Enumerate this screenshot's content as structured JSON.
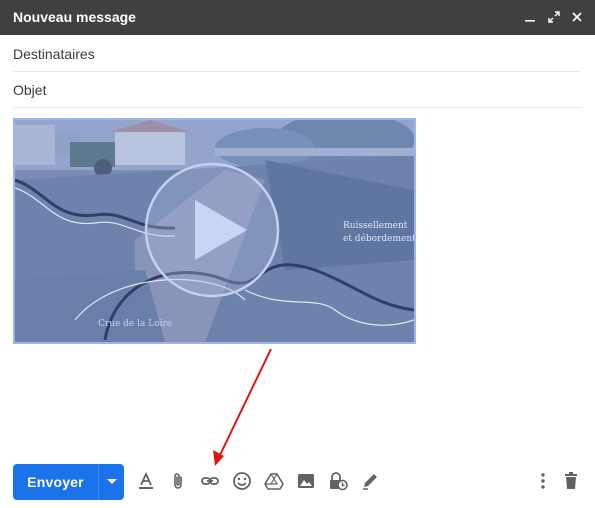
{
  "window": {
    "title": "Nouveau message",
    "controls": [
      "minimize-icon",
      "expand-icon",
      "close-icon"
    ]
  },
  "fields": {
    "recipients_placeholder": "Destinataires",
    "subject_placeholder": "Objet"
  },
  "video": {
    "caption_left": "Crue de la Loire",
    "caption_right_line1": "Ruissellement",
    "caption_right_line2": "et débordement"
  },
  "toolbar": {
    "send_label": "Envoyer",
    "send_options_icon": "caret-down-icon",
    "tools": [
      "format-text-icon",
      "attach-icon",
      "link-icon",
      "emoji-icon",
      "drive-icon",
      "photo-icon",
      "confidential-icon",
      "signature-icon"
    ],
    "more_icon": "more-vert-icon",
    "discard_icon": "trash-icon"
  },
  "colors": {
    "titlebar": "#404040",
    "send_button": "#1a73e8",
    "annotation_arrow": "#e0140e"
  }
}
